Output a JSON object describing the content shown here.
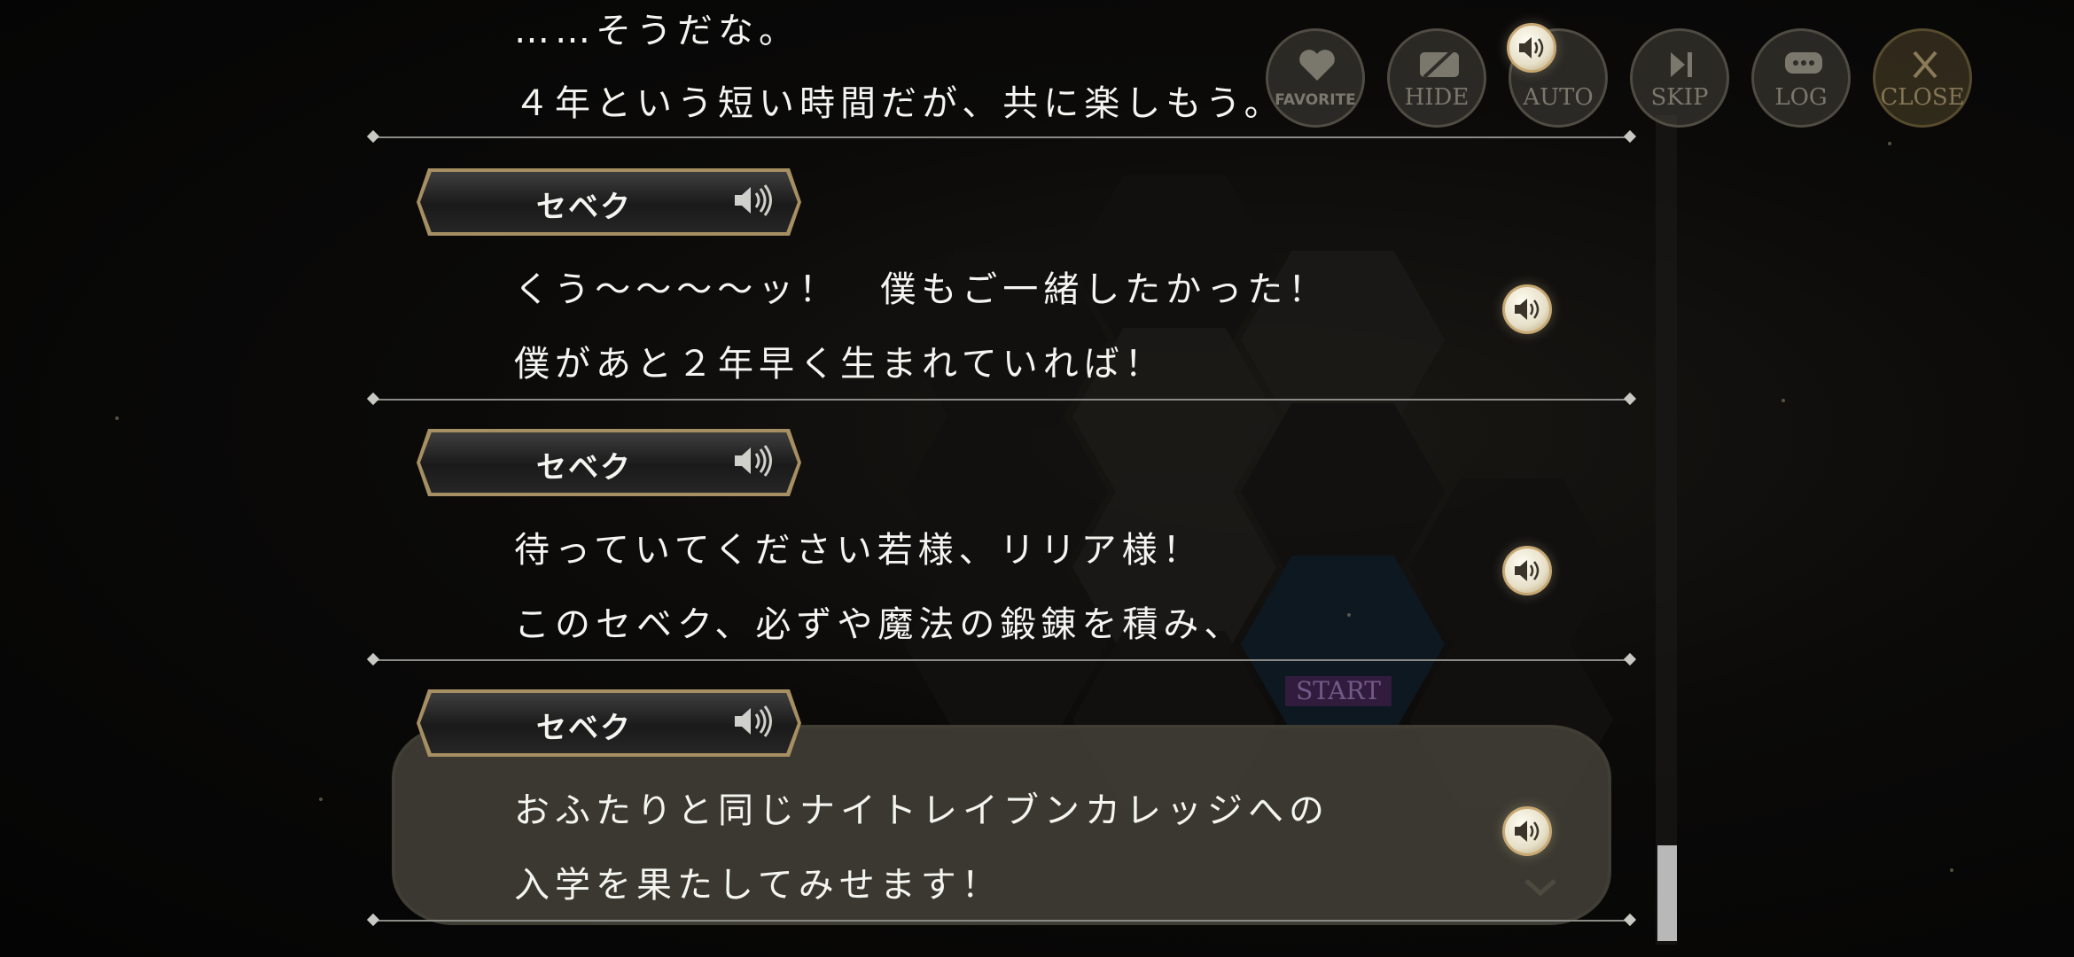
{
  "toolbar": {
    "favorite": "FAVORITE",
    "hide": "HIDE",
    "auto": "AUTO",
    "skip": "SKIP",
    "log": "LOG",
    "close": "CLOSE"
  },
  "background": {
    "start_label": "START"
  },
  "log": {
    "entries": [
      {
        "speaker": "",
        "lines": [
          "……そうだな。",
          "４年という短い時間だが、共に楽しもう。"
        ]
      },
      {
        "speaker": "セベク",
        "lines": [
          "くう～～～～ッ！　僕もご一緒したかった！",
          "僕があと２年早く生まれていれば！"
        ]
      },
      {
        "speaker": "セベク",
        "lines": [
          "待っていてください若様、リリア様！",
          "このセベク、必ずや魔法の鍛錬を積み、"
        ]
      },
      {
        "speaker": "セベク",
        "lines": [
          "おふたりと同じナイトレイブンカレッジへの",
          "入学を果たしてみせます！"
        ]
      }
    ]
  },
  "colors": {
    "accent_gold": "#c7a872",
    "divider": "#8a8a86",
    "text": "#f4f4f0"
  }
}
